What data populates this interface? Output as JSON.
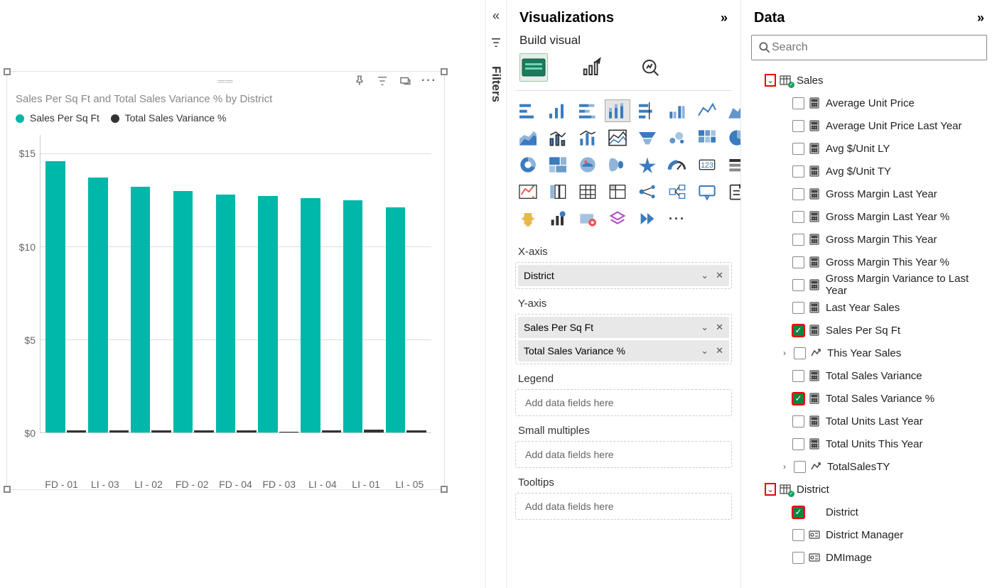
{
  "chart": {
    "title": "Sales Per Sq Ft and Total Sales Variance % by District",
    "legend1": "Sales Per Sq Ft",
    "legend2": "Total Sales Variance %",
    "color1": "#00b8a9",
    "color2": "#333333",
    "ylabels": [
      "$15",
      "$10",
      "$5",
      "$0"
    ]
  },
  "chart_data": {
    "type": "bar",
    "title": "Sales Per Sq Ft and Total Sales Variance % by District",
    "categories": [
      "FD - 01",
      "LI - 03",
      "LI - 02",
      "FD - 02",
      "FD - 04",
      "FD - 03",
      "LI - 04",
      "LI - 01",
      "LI - 05"
    ],
    "ylim": [
      0,
      16
    ],
    "ylabel": "",
    "xlabel": "",
    "series": [
      {
        "name": "Sales Per Sq Ft",
        "values": [
          14.6,
          13.7,
          13.2,
          13.0,
          12.8,
          12.7,
          12.6,
          12.5,
          12.1
        ]
      },
      {
        "name": "Total Sales Variance %",
        "values": [
          0.1,
          0.1,
          0.1,
          0.1,
          0.1,
          0.05,
          0.1,
          0.15,
          0.1
        ]
      }
    ]
  },
  "filters_label": "Filters",
  "viz": {
    "title": "Visualizations",
    "subtitle": "Build visual",
    "wells": {
      "xaxis": "X-axis",
      "yaxis": "Y-axis",
      "legend": "Legend",
      "small": "Small multiples",
      "tooltips": "Tooltips"
    },
    "placeholder": "Add data fields here",
    "x_pill": "District",
    "y_pill1": "Sales Per Sq Ft",
    "y_pill2": "Total Sales Variance %"
  },
  "data": {
    "title": "Data",
    "search_placeholder": "Search",
    "tables": [
      {
        "name": "Sales",
        "fields": [
          {
            "label": "Average Unit Price",
            "checked": false,
            "icon": "calc"
          },
          {
            "label": "Average Unit Price Last Year",
            "checked": false,
            "icon": "calc"
          },
          {
            "label": "Avg $/Unit LY",
            "checked": false,
            "icon": "calc"
          },
          {
            "label": "Avg $/Unit TY",
            "checked": false,
            "icon": "calc"
          },
          {
            "label": "Gross Margin Last Year",
            "checked": false,
            "icon": "calc"
          },
          {
            "label": "Gross Margin Last Year %",
            "checked": false,
            "icon": "calc"
          },
          {
            "label": "Gross Margin This Year",
            "checked": false,
            "icon": "calc"
          },
          {
            "label": "Gross Margin This Year %",
            "checked": false,
            "icon": "calc"
          },
          {
            "label": "Gross Margin Variance to Last Year",
            "checked": false,
            "icon": "calc"
          },
          {
            "label": "Last Year Sales",
            "checked": false,
            "icon": "calc"
          },
          {
            "label": "Sales Per Sq Ft",
            "checked": true,
            "icon": "calc"
          },
          {
            "label": "This Year Sales",
            "checked": false,
            "icon": "hier"
          },
          {
            "label": "Total Sales Variance",
            "checked": false,
            "icon": "calc"
          },
          {
            "label": "Total Sales Variance %",
            "checked": true,
            "icon": "calc"
          },
          {
            "label": "Total Units Last Year",
            "checked": false,
            "icon": "calc"
          },
          {
            "label": "Total Units This Year",
            "checked": false,
            "icon": "calc"
          },
          {
            "label": "TotalSalesTY",
            "checked": false,
            "icon": "hier"
          }
        ]
      },
      {
        "name": "District",
        "fields": [
          {
            "label": "District",
            "checked": true,
            "icon": "none"
          },
          {
            "label": "District Manager",
            "checked": false,
            "icon": "card"
          },
          {
            "label": "DMImage",
            "checked": false,
            "icon": "card"
          }
        ]
      }
    ]
  }
}
